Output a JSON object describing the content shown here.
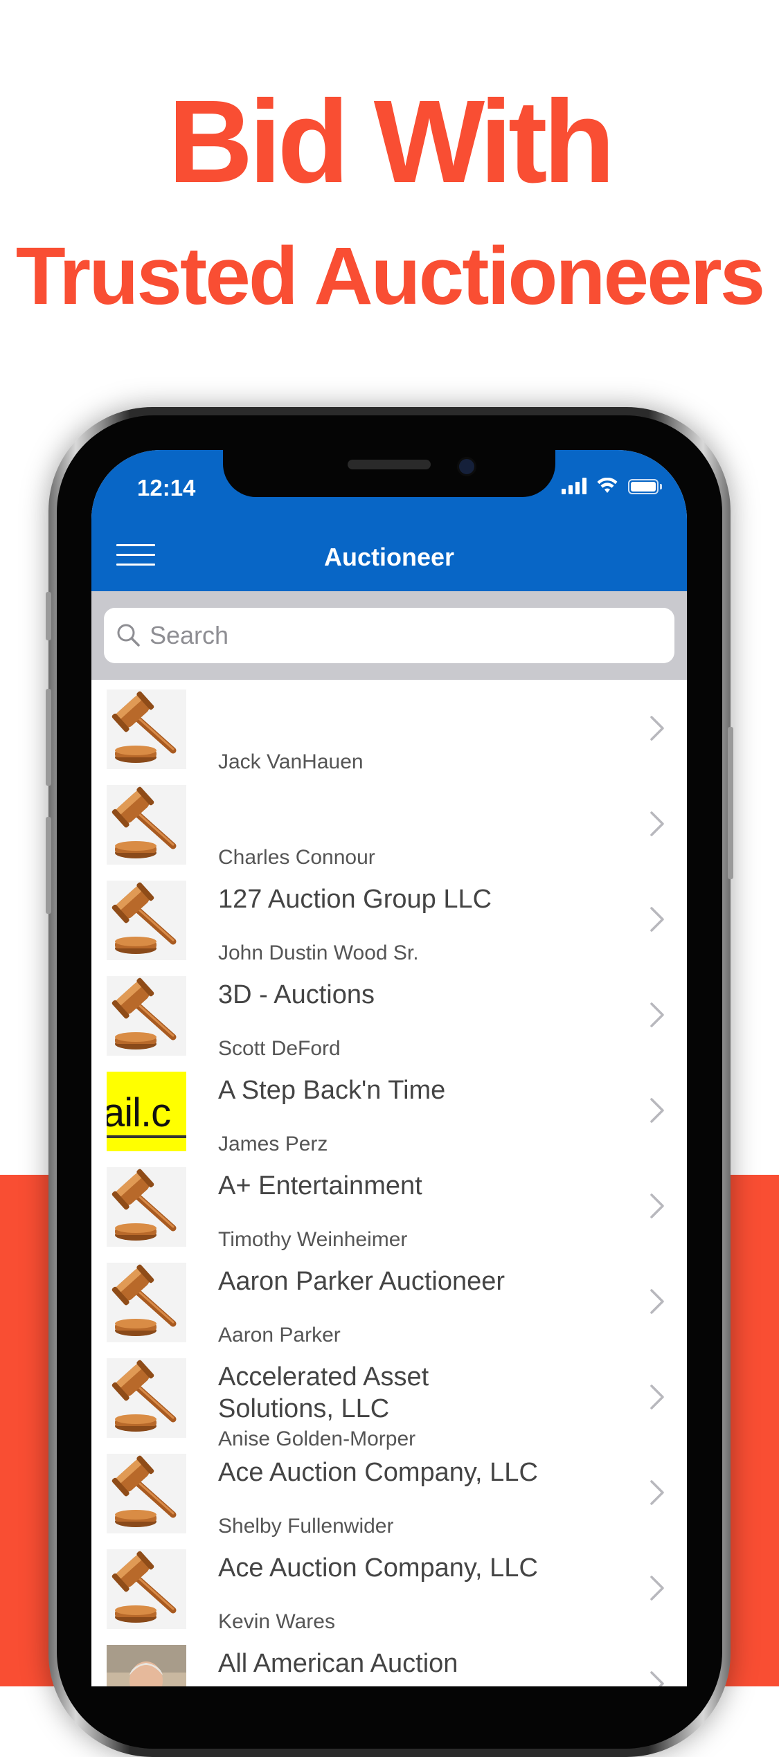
{
  "headline": {
    "line1": "Bid With",
    "line2": "Trusted Auctioneers"
  },
  "colors": {
    "accent": "#f94e33",
    "nav_blue": "#0866c6"
  },
  "status_bar": {
    "time": "12:14",
    "icons": [
      "signal-icon",
      "wifi-icon",
      "battery-icon"
    ]
  },
  "nav": {
    "title": "Auctioneer",
    "menu_icon": "hamburger-menu-icon"
  },
  "search": {
    "placeholder": "Search",
    "value": ""
  },
  "auctioneers": [
    {
      "company": "",
      "name": "Jack VanHauen",
      "image": "gavel-icon"
    },
    {
      "company": "",
      "name": "Charles Connour",
      "image": "gavel-icon"
    },
    {
      "company": "127 Auction Group LLC",
      "name": "John Dustin Wood Sr.",
      "image": "gavel-icon"
    },
    {
      "company": "3D - Auctions",
      "name": "Scott DeFord",
      "image": "gavel-icon"
    },
    {
      "company": "A Step Back'n Time",
      "name": "James Perz",
      "image": "logo-thumbnail",
      "thumb_text": "ail.c"
    },
    {
      "company": "A+ Entertainment",
      "name": "Timothy Weinheimer",
      "image": "gavel-icon"
    },
    {
      "company": "Aaron Parker Auctioneer",
      "name": "Aaron Parker",
      "image": "gavel-icon"
    },
    {
      "company": "Accelerated Asset Solutions, LLC",
      "name": "Anise Golden-Morper",
      "image": "gavel-icon"
    },
    {
      "company": "Ace Auction Company, LLC",
      "name": "Shelby Fullenwider",
      "image": "gavel-icon"
    },
    {
      "company": "Ace Auction Company, LLC",
      "name": "Kevin Wares",
      "image": "gavel-icon"
    },
    {
      "company": "All American Auction",
      "name": "",
      "image": "person-photo"
    }
  ]
}
